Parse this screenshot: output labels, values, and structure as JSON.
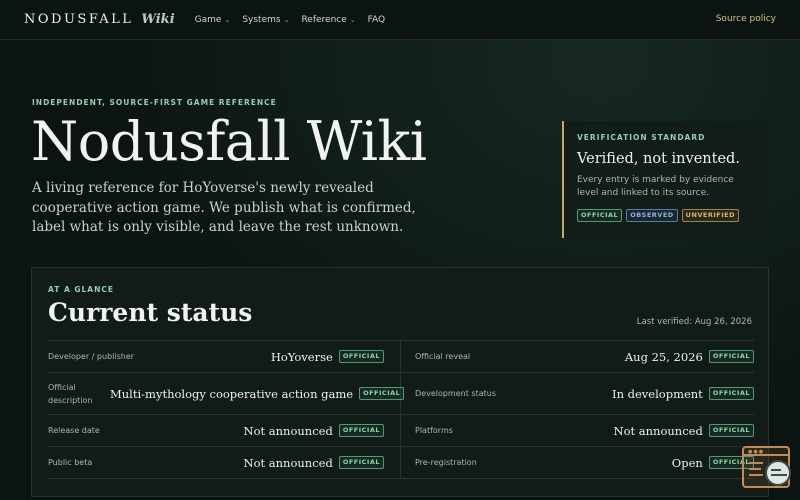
{
  "nav": {
    "brand_name": "NODUSFALL",
    "brand_suffix": "Wiki",
    "links": [
      {
        "label": "Game",
        "dropdown": true
      },
      {
        "label": "Systems",
        "dropdown": true
      },
      {
        "label": "Reference",
        "dropdown": true
      },
      {
        "label": "FAQ",
        "dropdown": false
      }
    ],
    "right_link": "Source policy"
  },
  "hero": {
    "eyebrow": "INDEPENDENT, SOURCE-FIRST GAME REFERENCE",
    "title": "Nodusfall Wiki",
    "description": "A living reference for HoYoverse's newly revealed cooperative action game. We publish what is confirmed, label what is only visible, and leave the rest unknown."
  },
  "verification": {
    "eyebrow": "VERIFICATION STANDARD",
    "title": "Verified, not invented.",
    "description": "Every entry is marked by evidence level and linked to its source.",
    "chips": [
      "OFFICIAL",
      "OBSERVED",
      "UNVERIFIED"
    ]
  },
  "status": {
    "eyebrow": "AT A GLANCE",
    "title": "Current status",
    "last_verified": "Last verified: Aug 26, 2026",
    "rows": [
      {
        "left": {
          "label": "Developer / publisher",
          "value": "HoYoverse",
          "badge": "OFFICIAL"
        },
        "right": {
          "label": "Official reveal",
          "value": "Aug 25, 2026",
          "badge": "OFFICIAL"
        }
      },
      {
        "left": {
          "label": "Official description",
          "value": "Multi-mythology cooperative action game",
          "badge": "OFFICIAL"
        },
        "right": {
          "label": "Development status",
          "value": "In development",
          "badge": "OFFICIAL"
        }
      },
      {
        "left": {
          "label": "Release date",
          "value": "Not announced",
          "badge": "OFFICIAL"
        },
        "right": {
          "label": "Platforms",
          "value": "Not announced",
          "badge": "OFFICIAL"
        }
      },
      {
        "left": {
          "label": "Public beta",
          "value": "Not announced",
          "badge": "OFFICIAL"
        },
        "right": {
          "label": "Pre-registration",
          "value": "Open",
          "badge": "OFFICIAL"
        }
      }
    ]
  },
  "colors": {
    "background": "#0c1411",
    "accent_green": "#8fd0b0",
    "accent_gold": "#c9a864",
    "link_gold": "#d7c27e"
  },
  "icons": {
    "widget": "help-widget-icon"
  }
}
